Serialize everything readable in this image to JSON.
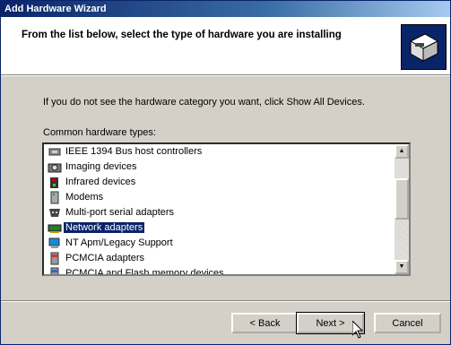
{
  "window": {
    "title": "Add Hardware Wizard"
  },
  "header": {
    "title": "From the list below, select the type of hardware you are installing"
  },
  "body": {
    "info_text": "If you do not see the hardware category you want, click Show All Devices.",
    "list_label": "Common hardware types:"
  },
  "list": {
    "items": [
      {
        "label": "IEEE 1394 Bus host controllers",
        "icon": "ieee1394-icon",
        "selected": false
      },
      {
        "label": "Imaging devices",
        "icon": "camera-icon",
        "selected": false
      },
      {
        "label": "Infrared devices",
        "icon": "infrared-icon",
        "selected": false
      },
      {
        "label": "Modems",
        "icon": "modem-icon",
        "selected": false
      },
      {
        "label": "Multi-port serial adapters",
        "icon": "serial-port-icon",
        "selected": false
      },
      {
        "label": "Network adapters",
        "icon": "network-adapter-icon",
        "selected": true
      },
      {
        "label": "NT Apm/Legacy Support",
        "icon": "computer-icon",
        "selected": false
      },
      {
        "label": "PCMCIA adapters",
        "icon": "pcmcia-icon",
        "selected": false
      },
      {
        "label": "PCMCIA and Flash memory devices",
        "icon": "pcmcia-flash-icon",
        "selected": false
      }
    ],
    "selection_color": "#0a246a"
  },
  "buttons": {
    "back": "< Back",
    "next": "Next >",
    "cancel": "Cancel"
  }
}
